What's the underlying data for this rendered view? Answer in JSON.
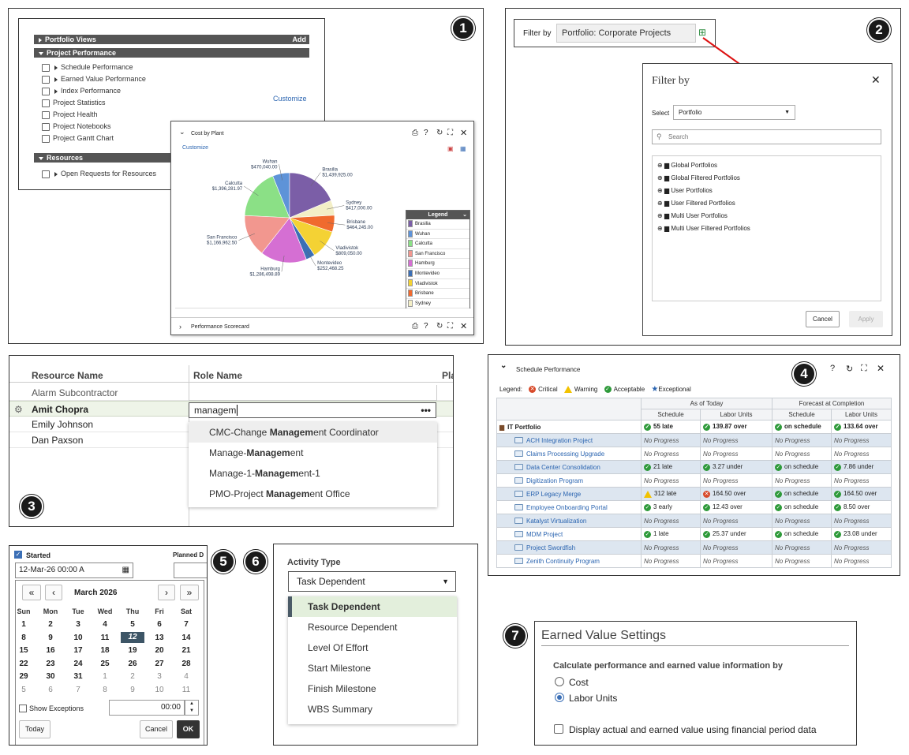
{
  "badges": [
    "1",
    "2",
    "3",
    "4",
    "5",
    "6",
    "7"
  ],
  "p1": {
    "portfolio_views": "Portfolio Views",
    "add": "Add",
    "project_performance": "Project Performance",
    "items": [
      "Schedule Performance",
      "Earned Value Performance",
      "Index Performance",
      "Project Statistics",
      "Project Health",
      "Project Notebooks",
      "Project Gantt Chart"
    ],
    "customize": "Customize",
    "resources": "Resources",
    "open_requests": "Open Requests for Resources",
    "chart_panel_title": "Cost by Plant",
    "chart_customize": "Customize",
    "legend_title": "Legend",
    "performance_scorecard": "Performance Scorecard"
  },
  "chart_data": {
    "type": "pie",
    "categories": [
      "Brasilia",
      "Wuhan",
      "Calcutta",
      "San Francisco",
      "Hamburg",
      "Montevideo",
      "Vladivistok",
      "Brisbane",
      "Sydney"
    ],
    "values": [
      1439925.0,
      470040.0,
      1396281.97,
      1166962.5,
      1286498.89,
      252468.25,
      809050.0,
      464245.0,
      417000.0
    ],
    "labels": [
      "$1,439,925.00",
      "$470,040.00",
      "$1,396,281.97",
      "$1,166,962.50",
      "$1,286,498.89",
      "$252,468.25",
      "$809,050.00",
      "$464,245.00",
      "$417,000.00"
    ],
    "colors": [
      "#7b5ea7",
      "#5e93d8",
      "#8be086",
      "#f2978f",
      "#d56fd3",
      "#3c6fb5",
      "#f4d234",
      "#f06a2e",
      "#f3eec6"
    ],
    "legend": "right"
  },
  "p2": {
    "filter_by_label": "Filter by",
    "filter_value": "Portfolio: Corporate Projects",
    "dialog_title": "Filter by",
    "select_label": "Select",
    "select_value": "Portfolio",
    "search_placeholder": "Search",
    "tree": [
      "Global Portfolios",
      "Global Filtered Portfolios",
      "User Portfolios",
      "User Filtered Portfolios",
      "Multi User Portfolios",
      "Multi User Filtered Portfolios"
    ],
    "cancel": "Cancel",
    "apply": "Apply"
  },
  "p3": {
    "col_resource": "Resource Name",
    "col_role": "Role Name",
    "col_pla": "Pla",
    "rows": [
      "Alarm Subcontractor",
      "Amit Chopra",
      "Emily Johnson",
      "Dan Paxson"
    ],
    "input_value": "managem",
    "suggestions": [
      {
        "pre": "CMC-Change ",
        "bold": "Managem",
        "post": "ent Coordinator"
      },
      {
        "pre": "Manage-",
        "bold": "Managem",
        "post": "ent"
      },
      {
        "pre": "Manage-1-",
        "bold": "Managem",
        "post": "ent-1"
      },
      {
        "pre": "PMO-Project ",
        "bold": "Managem",
        "post": "ent Office"
      }
    ]
  },
  "p4": {
    "title": "Schedule Performance",
    "legend_label": "Legend:",
    "legend": [
      "Critical",
      "Warning",
      "Acceptable",
      "Exceptional"
    ],
    "grp_today": "As of Today",
    "grp_forecast": "Forecast at Completion",
    "h_schedule": "Schedule",
    "h_labor": "Labor Units",
    "rows": [
      {
        "name": "IT Portfolio",
        "s1": "55 late",
        "l1": "139.87 over",
        "s2": "on schedule",
        "l2": "133.64 over"
      },
      {
        "name": "ACH Integration Project",
        "s1": "No Progress",
        "l1": "No Progress",
        "s2": "No Progress",
        "l2": "No Progress"
      },
      {
        "name": "Claims Processing Upgrade",
        "s1": "No Progress",
        "l1": "No Progress",
        "s2": "No Progress",
        "l2": "No Progress"
      },
      {
        "name": "Data Center Consolidation",
        "s1": "21 late",
        "l1": "3.27 under",
        "s2": "on schedule",
        "l2": "7.86 under"
      },
      {
        "name": "Digitization Program",
        "s1": "No Progress",
        "l1": "No Progress",
        "s2": "No Progress",
        "l2": "No Progress"
      },
      {
        "name": "ERP Legacy Merge",
        "s1": "312 late",
        "l1": "164.50 over",
        "s2": "on schedule",
        "l2": "164.50 over"
      },
      {
        "name": "Employee Onboarding Portal",
        "s1": "3 early",
        "l1": "12.43 over",
        "s2": "on schedule",
        "l2": "8.50 over"
      },
      {
        "name": "Katalyst Virtualization",
        "s1": "No Progress",
        "l1": "No Progress",
        "s2": "No Progress",
        "l2": "No Progress"
      },
      {
        "name": "MDM Project",
        "s1": "1 late",
        "l1": "25.37 under",
        "s2": "on schedule",
        "l2": "23.08 under"
      },
      {
        "name": "Project Swordfish",
        "s1": "No Progress",
        "l1": "No Progress",
        "s2": "No Progress",
        "l2": "No Progress"
      },
      {
        "name": "Zenith Continuity Program",
        "s1": "No Progress",
        "l1": "No Progress",
        "s2": "No Progress",
        "l2": "No Progress"
      }
    ]
  },
  "p5": {
    "started": "Started",
    "planned": "Planned D",
    "date_value": "12-Mar-26 00:00 A",
    "month": "March 2026",
    "days": [
      "Sun",
      "Mon",
      "Tue",
      "Wed",
      "Thu",
      "Fri",
      "Sat"
    ],
    "weeks": [
      [
        "1",
        "2",
        "3",
        "4",
        "5",
        "6",
        "7"
      ],
      [
        "8",
        "9",
        "10",
        "11",
        "12",
        "13",
        "14"
      ],
      [
        "15",
        "16",
        "17",
        "18",
        "19",
        "20",
        "21"
      ],
      [
        "22",
        "23",
        "24",
        "25",
        "26",
        "27",
        "28"
      ],
      [
        "29",
        "30",
        "31",
        "1",
        "2",
        "3",
        "4"
      ],
      [
        "5",
        "6",
        "7",
        "8",
        "9",
        "10",
        "11"
      ]
    ],
    "show_exceptions": "Show Exceptions",
    "time": "00:00",
    "today": "Today",
    "cancel": "Cancel",
    "ok": "OK"
  },
  "p6": {
    "label": "Activity Type",
    "value": "Task Dependent",
    "options": [
      "Task Dependent",
      "Resource Dependent",
      "Level Of Effort",
      "Start Milestone",
      "Finish Milestone",
      "WBS Summary"
    ]
  },
  "p7": {
    "title": "Earned Value Settings",
    "calc_label": "Calculate performance and earned value information by",
    "opt_cost": "Cost",
    "opt_labor": "Labor Units",
    "fin_period": "Display actual and earned value using financial period data"
  }
}
